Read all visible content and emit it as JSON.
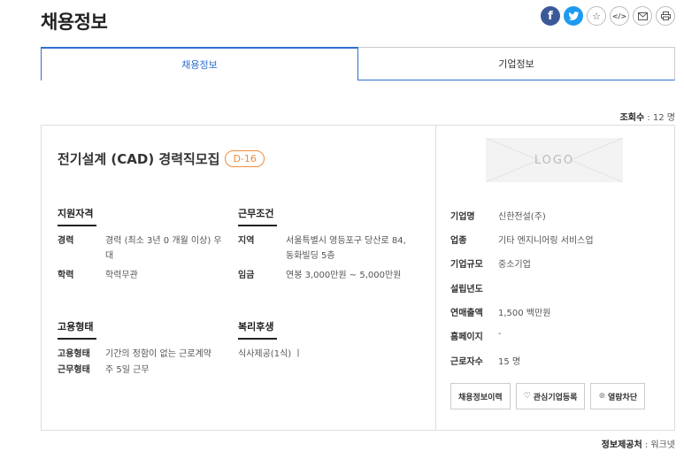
{
  "header": {
    "title": "채용정보"
  },
  "share": {
    "facebook": "f",
    "code": "</>"
  },
  "tabs": [
    {
      "label": "채용정보"
    },
    {
      "label": "기업정보"
    }
  ],
  "views": {
    "label": "조회수",
    "value": " : 12 명"
  },
  "job": {
    "title": "전기설계 (CAD) 경력직모집",
    "dday": "D-16",
    "qualification": {
      "heading": "지원자격",
      "rows": [
        {
          "key": "경력",
          "value": "경력 (최소 3년 0 개월 이상) 우\n대"
        },
        {
          "key": "학력",
          "value": "학력무관"
        }
      ]
    },
    "conditions": {
      "heading": "근무조건",
      "rows": [
        {
          "key": "지역",
          "value": "서울특별시 영등포구 당산로 84,\n동화빌딩 5층"
        },
        {
          "key": "임금",
          "value": "연봉 3,000만원 ~ 5,000만원"
        }
      ]
    },
    "employment": {
      "heading": "고용형태",
      "rows": [
        {
          "key": "고용형태",
          "value": "기간의 정함이 없는 근로계약"
        },
        {
          "key": "근무형태",
          "value": "주 5일 근무"
        }
      ]
    },
    "welfare": {
      "heading": "복리후생",
      "value": "식사제공(1식) ㅣ"
    }
  },
  "company": {
    "logo_text": "LOGO",
    "rows": [
      {
        "key": "기업명",
        "value": "신한전설(주)"
      },
      {
        "key": "업종",
        "value": "기타 엔지니어링 서비스업"
      },
      {
        "key": "기업규모",
        "value": "중소기업"
      },
      {
        "key": "설립년도",
        "value": ""
      },
      {
        "key": "연매출액",
        "value": "1,500 백만원"
      },
      {
        "key": "홈페이지",
        "value": "-"
      },
      {
        "key": "근로자수",
        "value": "15 명"
      }
    ],
    "buttons": {
      "history": "채용정보이력",
      "interest": "관심기업등록",
      "block": "열람차단"
    }
  },
  "footer": {
    "provider_label": "정보제공처",
    "provider_value": " : 워크넷"
  }
}
